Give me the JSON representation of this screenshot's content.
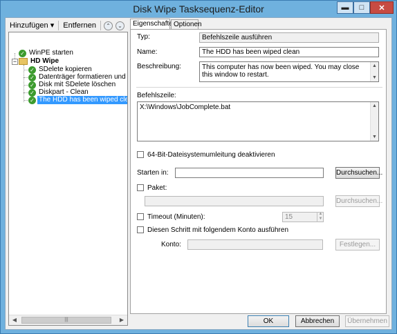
{
  "window": {
    "title": "Disk Wipe Tasksequenz-Editor",
    "min_glyph": "▬",
    "max_glyph": "□",
    "close_glyph": "✕"
  },
  "toolbar": {
    "add_label": "Hinzufügen ▾",
    "remove_label": "Entfernen",
    "up_glyph": "⌃",
    "down_glyph": "⌄"
  },
  "tree": {
    "root": "WinPE starten",
    "group": "HD Wipe",
    "expander": "−",
    "children": [
      "SDelete kopieren",
      "Datenträger formatieren und partit",
      "Disk mit SDelete löschen",
      "Diskpart - Clean",
      "The HDD has been wiped clean"
    ],
    "check_glyph": "✓",
    "scroll_left": "◀",
    "scroll_right": "▶",
    "scroll_grip": "|||"
  },
  "tabs": [
    "Eigenschaften",
    "Optionen"
  ],
  "properties": {
    "type_label": "Typ:",
    "type_value": "Befehlszeile ausführen",
    "name_label": "Name:",
    "name_value": "The HDD has been wiped clean",
    "desc_label": "Beschreibung:",
    "desc_value": "This computer has now been wiped. You may close this window to restart.",
    "cmd_label": "Befehlszeile:",
    "cmd_value": "X:\\Windows\\JobComplete.bat",
    "redirect_label": "64-Bit-Dateisystemumleitung deaktivieren",
    "start_label": "Starten in:",
    "start_value": "",
    "browse_label": "Durchsuchen...",
    "package_label": "Paket:",
    "package_value": "",
    "browse2_label": "Durchsuchen...",
    "timeout_label": "Timeout (Minuten):",
    "timeout_value": "15",
    "account_check_label": "Diesen Schritt mit folgendem Konto ausführen",
    "account_label": "Konto:",
    "account_value": "",
    "set_label": "Festlegen..."
  },
  "footer": {
    "ok": "OK",
    "cancel": "Abbrechen",
    "apply": "Übernehmen"
  },
  "colors": {
    "selection": "#3399ff",
    "check_green": "#3c9b2e",
    "window_frame": "#6fb1de",
    "close_red": "#c74b42"
  },
  "icons": {
    "step": "check-circle-icon",
    "group": "folder-icon"
  }
}
